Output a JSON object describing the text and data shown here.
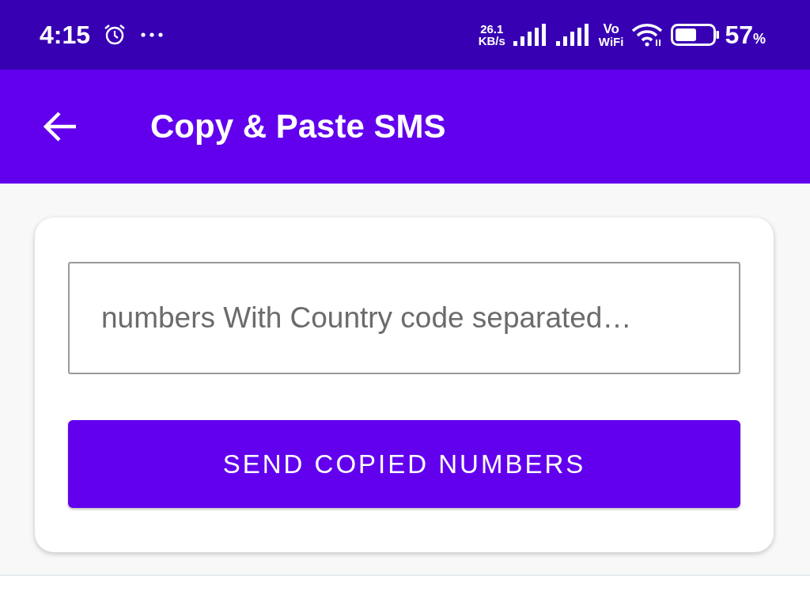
{
  "status_bar": {
    "time": "4:15",
    "speed_value": "26.1",
    "speed_unit": "KB/s",
    "volte_top": "Vo",
    "volte_bottom": "WiFi",
    "battery_value": "57",
    "battery_unit": "%"
  },
  "app_bar": {
    "title": "Copy & Paste SMS"
  },
  "form": {
    "numbers_field": {
      "placeholder": "numbers With Country code separated…"
    },
    "button": "SEND COPIED NUMBERS"
  }
}
